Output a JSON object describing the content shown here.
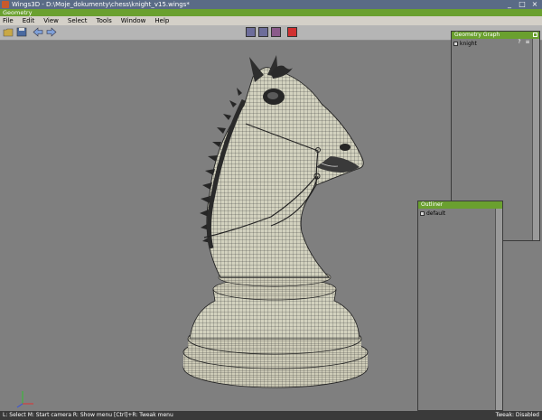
{
  "window": {
    "title": "Wings3D - D:\\Moje_dokumenty\\chess\\knight_v15.wings*",
    "min_label": "_",
    "max_label": "□",
    "close_label": "×"
  },
  "geometry_header": "Geometry",
  "menu": [
    "File",
    "Edit",
    "View",
    "Select",
    "Tools",
    "Window",
    "Help"
  ],
  "selection_modes": [
    {
      "name": "vertex",
      "color": "#6d6d9a"
    },
    {
      "name": "edge",
      "color": "#6d6d9a"
    },
    {
      "name": "face",
      "color": "#8a5a8a"
    },
    {
      "name": "body",
      "color": "#d03030"
    }
  ],
  "geometry_graph": {
    "title": "Geometry Graph",
    "items": [
      {
        "label": "knight"
      }
    ],
    "help": "?"
  },
  "outliner": {
    "title": "Outliner",
    "items": [
      {
        "label": "default"
      }
    ]
  },
  "status": {
    "left": "L: Select   M: Start camera   R: Show menu   [Ctrl]+R: Tweak menu",
    "right": "Tweak: Disabled"
  },
  "colors": {
    "mesh": "#d6d5c2",
    "wire": "#2a2a2a",
    "panel_header": "#6aa02f"
  }
}
